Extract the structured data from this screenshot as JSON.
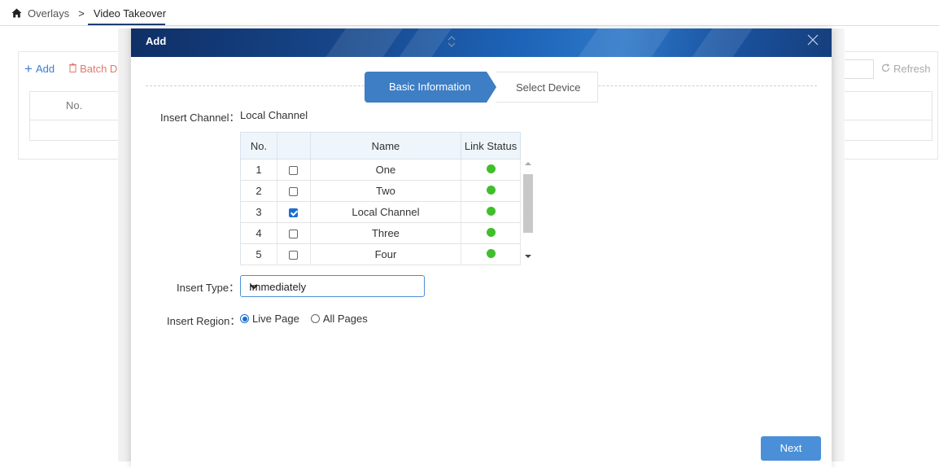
{
  "breadcrumb": {
    "home_icon": "home-icon",
    "parent": "Overlays",
    "separator": ">",
    "current": "Video Takeover"
  },
  "background": {
    "add_label": "Add",
    "batch_delete_label": "Batch Dele",
    "refresh_label": "Refresh",
    "col_no": "No."
  },
  "modal": {
    "title": "Add",
    "steps": [
      "Basic Information",
      "Select Device"
    ],
    "insert_channel_label": "Insert Channel：",
    "insert_channel_value": "Local Channel",
    "table": {
      "headers": [
        "No.",
        "",
        "Name",
        "Link Status"
      ],
      "rows": [
        {
          "no": "1",
          "checked": false,
          "name": "One",
          "status": "online"
        },
        {
          "no": "2",
          "checked": false,
          "name": "Two",
          "status": "online"
        },
        {
          "no": "3",
          "checked": true,
          "name": "Local Channel",
          "status": "online"
        },
        {
          "no": "4",
          "checked": false,
          "name": "Three",
          "status": "online"
        },
        {
          "no": "5",
          "checked": false,
          "name": "Four",
          "status": "online"
        }
      ]
    },
    "insert_type_label": "Insert Type：",
    "insert_type_value": "Immediately",
    "insert_region_label": "Insert Region：",
    "region_options": [
      "Live Page",
      "All Pages"
    ],
    "region_selected": "Live Page",
    "next_label": "Next"
  },
  "colors": {
    "accent": "#3e7ec4",
    "status_online": "#3fbf2a",
    "header_dark": "#0f2f66"
  }
}
